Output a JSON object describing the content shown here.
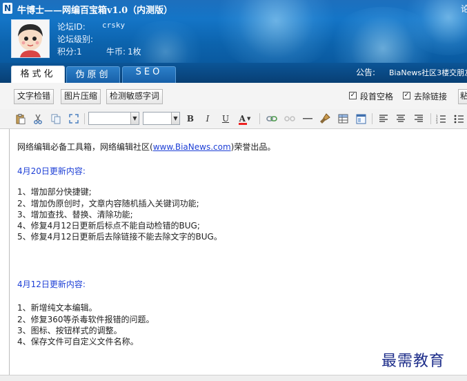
{
  "app": {
    "title": "牛博士——网编百宝箱v1.0（内测版）",
    "title_right_fragment": "论"
  },
  "user": {
    "forum_id_label": "论坛ID:",
    "forum_id_value": "crsky",
    "forum_level_label": "论坛级别:",
    "points_label": "积分:",
    "points_value": "1",
    "coins_label": "牛币:",
    "coins_value": "1枚"
  },
  "tabs": [
    {
      "label": "格式化",
      "active": true
    },
    {
      "label": "伪原创",
      "active": false
    },
    {
      "label": "SEO",
      "active": false
    }
  ],
  "announcement": {
    "label": "公告:",
    "text": "BiaNews社区3楼交朋友"
  },
  "funcbar": {
    "buttons": [
      "文字检错",
      "图片压缩",
      "检测敏感字词"
    ],
    "checkboxes": [
      {
        "label": "段首空格",
        "checked": true
      },
      {
        "label": "去除链接",
        "checked": true
      }
    ],
    "edge_button_fragment": "粘"
  },
  "editor_toolbar": {
    "icons": [
      "paste-icon",
      "cut-icon",
      "copy-icon",
      "fullscreen-icon",
      "bold-icon",
      "italic-icon",
      "underline-icon",
      "font-color-icon",
      "insert-link-icon",
      "unlink-icon",
      "horizontal-rule-icon",
      "format-brush-icon",
      "insert-table-icon",
      "source-icon",
      "align-left-icon",
      "align-center-icon",
      "align-right-icon",
      "ordered-list-icon",
      "unordered-list-icon"
    ],
    "bold_glyph": "B",
    "italic_glyph": "I",
    "underline_glyph": "U",
    "fontcolor_glyph": "A"
  },
  "content": {
    "intro_prefix": "网络编辑必备工具箱，网络编辑社区(",
    "intro_link": "www.BiaNews.com",
    "intro_suffix": ")荣誉出品。",
    "update1_title": "4月20日更新内容:",
    "update1_items": [
      "1、增加部分快捷键;",
      "2、增加伪原创时，文章内容随机插入关键词功能;",
      "3、增加查找、替换、清除功能;",
      "4、修复4月12日更新后标点不能自动检错的BUG;",
      "5、修复4月12日更新后去除链接不能去除文字的BUG。"
    ],
    "update2_title": "4月12日更新内容:",
    "update2_items": [
      "1、新增纯文本编辑。",
      "2、修复360等杀毒软件报错的问题。",
      "3、图标、按钮样式的调整。",
      "4、保存文件可自定义文件名称。"
    ]
  },
  "watermark": "最需教育",
  "colors": {
    "header_blue": "#1475c7",
    "tab_bar_dark": "#083f74",
    "link_blue": "#1d3fd6",
    "watermark_navy": "#1d2d8a"
  }
}
